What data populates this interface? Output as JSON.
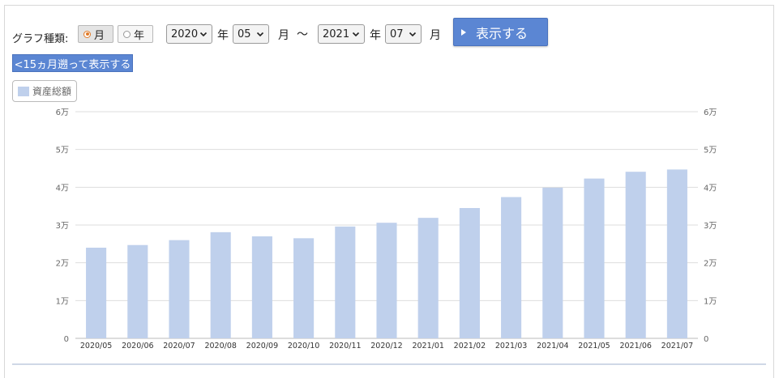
{
  "controls": {
    "type_label": "グラフ種類:",
    "radio_month": "月",
    "radio_year": "年",
    "selected_mode": "month",
    "start_year": "2020",
    "start_month": "05",
    "end_year": "2021",
    "end_month": "07",
    "unit_year": "年",
    "unit_month": "月",
    "range_sep": "〜",
    "show_button": "表示する",
    "back_button": "<15ヵ月遡って表示する"
  },
  "legend": {
    "label": "資産総額",
    "color": "#bfd0ec"
  },
  "chart_data": {
    "type": "bar",
    "categories": [
      "2020/05",
      "2020/06",
      "2020/07",
      "2020/08",
      "2020/09",
      "2020/10",
      "2020/11",
      "2020/12",
      "2021/01",
      "2021/02",
      "2021/03",
      "2021/04",
      "2021/05",
      "2021/06",
      "2021/07"
    ],
    "series": [
      {
        "name": "資産総額",
        "values": [
          24000,
          24700,
          26000,
          28100,
          27000,
          26500,
          29600,
          30600,
          31900,
          34500,
          37400,
          39900,
          42300,
          44100,
          44700
        ]
      }
    ],
    "ylim": [
      0,
      60000
    ],
    "yticks": [
      0,
      10000,
      20000,
      30000,
      40000,
      50000,
      60000
    ],
    "ytick_labels": [
      "0",
      "1万",
      "2万",
      "3万",
      "4万",
      "5万",
      "6万"
    ],
    "right_axis": true,
    "grid": true,
    "bar_color": "#bfd0ec",
    "grid_color": "#dddddd"
  }
}
